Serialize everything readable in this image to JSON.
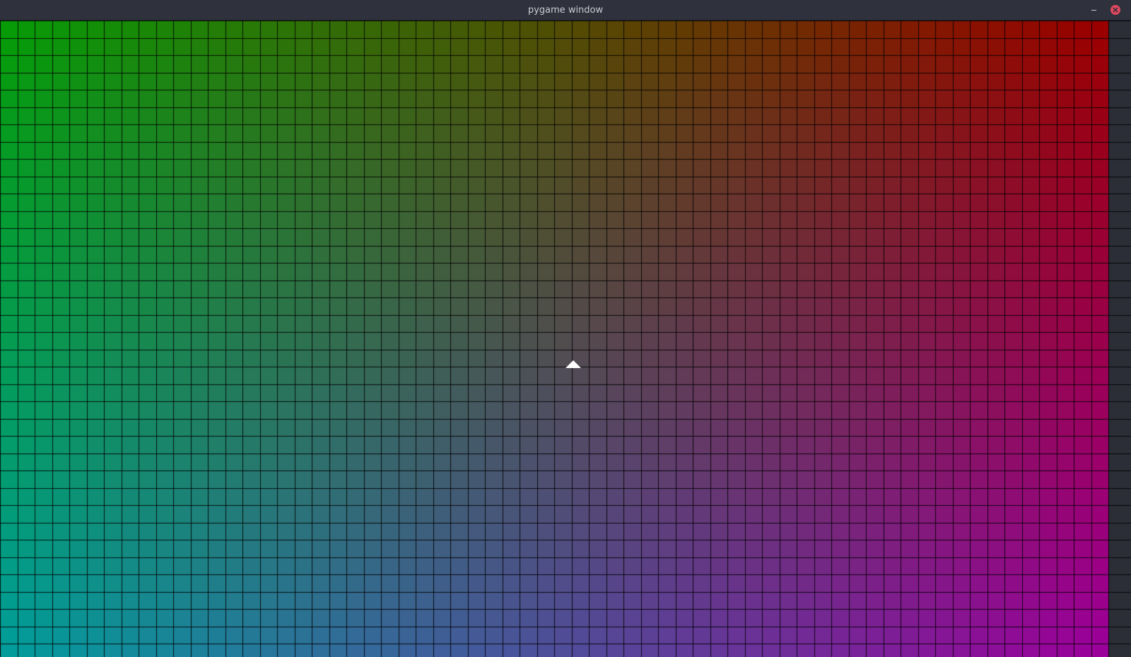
{
  "window": {
    "title": "pygame window",
    "minimize_icon": "minimize-icon",
    "close_icon": "close-icon",
    "close_color": "#e0475f"
  },
  "game": {
    "grid": {
      "columns": 64,
      "rows": 37
    },
    "corner_colors": {
      "top_left": "#079b08",
      "top_right": "#9a0000",
      "bottom_left": "#029c9b",
      "bottom_right": "#9b009a",
      "center": "#4f4e55"
    },
    "gridline_color": "#000000",
    "player": {
      "icon": "white-triangle-arrow-icon",
      "color": "#ffffff"
    }
  }
}
